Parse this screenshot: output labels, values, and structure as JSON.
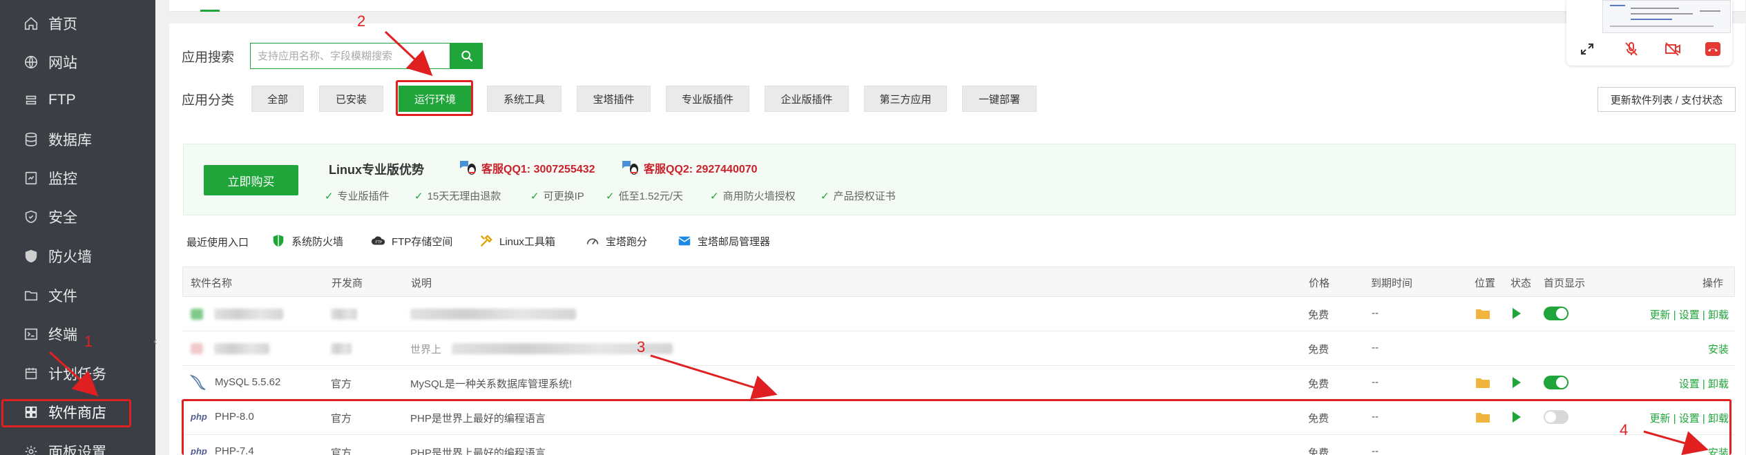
{
  "sidebar": {
    "items": [
      {
        "label": "首页",
        "icon": "home-icon"
      },
      {
        "label": "网站",
        "icon": "globe-icon"
      },
      {
        "label": "FTP",
        "icon": "ftp-icon"
      },
      {
        "label": "数据库",
        "icon": "database-icon"
      },
      {
        "label": "监控",
        "icon": "monitor-icon"
      },
      {
        "label": "安全",
        "icon": "shield-icon"
      },
      {
        "label": "防火墙",
        "icon": "firewall-icon"
      },
      {
        "label": "文件",
        "icon": "folder-icon"
      },
      {
        "label": "终端",
        "icon": "terminal-icon"
      },
      {
        "label": "计划任务",
        "icon": "calendar-icon"
      },
      {
        "label": "软件商店",
        "icon": "grid-icon",
        "active": true
      },
      {
        "label": "面板设置",
        "icon": "settings-icon"
      }
    ]
  },
  "search": {
    "label": "应用搜索",
    "placeholder": "支持应用名称、字段模糊搜索"
  },
  "categories": {
    "label": "应用分类",
    "items": [
      "全部",
      "已安装",
      "运行环境",
      "系统工具",
      "宝塔插件",
      "专业版插件",
      "企业版插件",
      "第三方应用",
      "一键部署"
    ],
    "active": "运行环境",
    "update_button": "更新软件列表 / 支付状态"
  },
  "promo": {
    "buy_button": "立即购买",
    "title": "Linux专业版优势",
    "qq1": "客服QQ1: 3007255432",
    "qq2": "客服QQ2: 2927440070",
    "features": [
      "专业版插件",
      "15天无理由退款",
      "可更换IP",
      "低至1.52元/天",
      "商用防火墙授权",
      "产品授权证书"
    ]
  },
  "recent": {
    "label": "最近使用入口",
    "items": [
      "系统防火墙",
      "FTP存储空间",
      "Linux工具箱",
      "宝塔跑分",
      "宝塔邮局管理器"
    ]
  },
  "table": {
    "headers": [
      "软件名称",
      "开发商",
      "说明",
      "价格",
      "到期时间",
      "位置",
      "状态",
      "首页显示",
      "操作"
    ],
    "rows": [
      {
        "name": "",
        "dev": "",
        "desc": "",
        "price": "免费",
        "expire": "--",
        "actions": "更新 | 设置 | 卸载",
        "toggle": "on",
        "blurred": true
      },
      {
        "name": "",
        "dev": "",
        "desc": "世界上",
        "price": "免费",
        "expire": "--",
        "actions": "安装",
        "blurred": true
      },
      {
        "name": "MySQL 5.5.62",
        "dev": "官方",
        "desc": "MySQL是一种关系数据库管理系统!",
        "price": "免费",
        "expire": "--",
        "actions": "设置 | 卸载",
        "toggle": "on"
      },
      {
        "name": "PHP-8.0",
        "dev": "官方",
        "desc": "PHP是世界上最好的编程语言",
        "price": "免费",
        "expire": "--",
        "actions": "更新 | 设置 | 卸载",
        "toggle": "off"
      },
      {
        "name": "PHP-7.4",
        "dev": "官方",
        "desc": "PHP是世界上最好的编程语言",
        "price": "免费",
        "expire": "--",
        "actions": "安装"
      }
    ]
  },
  "annotations": [
    "1",
    "2",
    "3",
    "4"
  ],
  "colors": {
    "accent": "#20a53a",
    "sidebar": "#3b3e45",
    "annotation": "#e02020",
    "qq": "#c9202b"
  }
}
